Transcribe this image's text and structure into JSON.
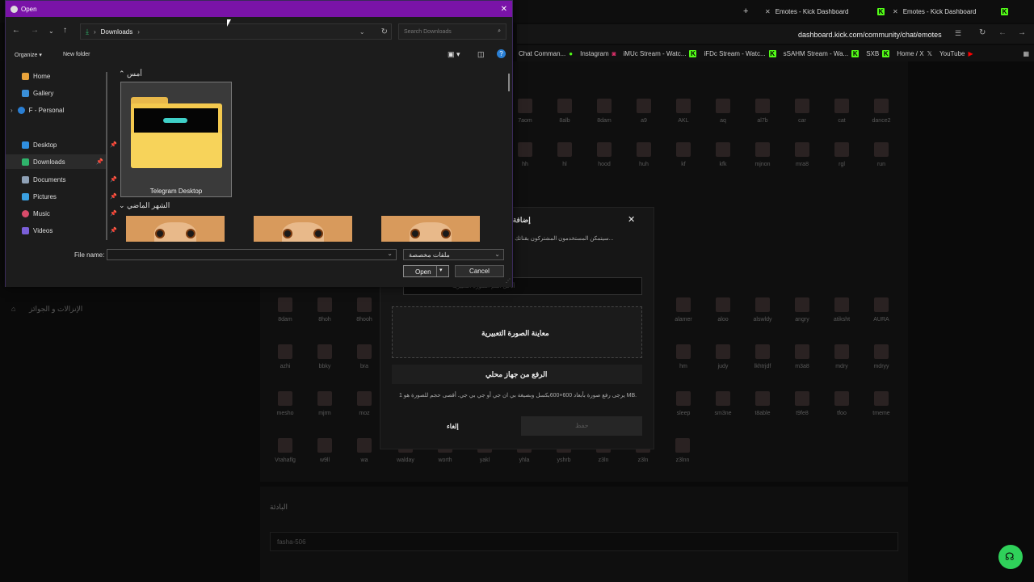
{
  "browser": {
    "tabs": [
      {
        "title": "Emotes - Kick Dashboard"
      },
      {
        "title": "Emotes - Kick Dashboard"
      }
    ],
    "new_tab": "+",
    "url": "dashboard.kick.com/community/chat/emotes",
    "bookmarks": [
      "Chat Comman...",
      "Instagram",
      "iMUc Stream - Watc...",
      "iFDc Stream - Watc...",
      "sSAHM Stream - Wa...",
      "SXB",
      "Home / X",
      "YouTube"
    ]
  },
  "page": {
    "sidebar_item": "الإنزالات و الجوائز",
    "section_label": "البادئة",
    "prefix_value": "fasha-506",
    "emote_labels_top": [
      "7aom",
      "8alb",
      "8dam",
      "a9",
      "AKL",
      "aq",
      "al7b",
      "car",
      "cat",
      "dance2"
    ],
    "emote_labels_row2": [
      "hh",
      "hl",
      "hood",
      "huh",
      "kf",
      "kfk",
      "mjnon",
      "mra8",
      "rgl",
      "run"
    ],
    "emote_labels_left": [
      "8dam",
      "8hoh",
      "8hooh",
      "azhi",
      "bbky",
      "bra",
      "mesho",
      "mjrm",
      "moz",
      "Vrahaflg",
      "w9ll",
      "wa"
    ],
    "emote_labels_right": [
      "alamer",
      "aloo",
      "alswldy",
      "angry",
      "atiksht",
      "AURA",
      "hm",
      "judy",
      "lkhtrjdf",
      "m3a8",
      "mdry",
      "mdryy",
      "sleep",
      "sm3ne",
      "t8able",
      "t9fe8",
      "tfoo",
      "tmeme",
      "walday",
      "worth",
      "yakl",
      "yhla",
      "yshrb",
      "z3ln",
      "z3ln",
      "z3lnn"
    ]
  },
  "modal": {
    "title": "إضافة الم",
    "desc": "سيتمكن المستخدمون المشتركون بقناتك م...",
    "input_placeholder": "أدخل اسم الصورة التعبيرية",
    "preview": "معاينة الصورة التعبيرية",
    "upload": "الرفع من جهاز محلي",
    "hint": "يرجى رفع صورة بأبعاد 600×600بكسل وبصيغة بي ان جي أو جي بي جي. أقصى حجم للصورة هو 1 MB.",
    "cancel": "إلغاء",
    "save": "حفظ"
  },
  "dialog": {
    "title": "Open",
    "path_folder": "Downloads",
    "search_placeholder": "Search Downloads",
    "organize": "Organize",
    "new_folder": "New folder",
    "sidebar": [
      {
        "label": "Home",
        "icon": "home-icon",
        "color": "#e8a33b"
      },
      {
        "label": "Gallery",
        "icon": "gallery-icon",
        "color": "#3a8fd8"
      },
      {
        "label": "F - Personal",
        "icon": "cloud-icon",
        "color": "#2a7fd4"
      },
      {
        "label": "Desktop",
        "icon": "desktop-icon",
        "color": "#2f8fe0"
      },
      {
        "label": "Downloads",
        "icon": "download-icon",
        "color": "#2fb36b"
      },
      {
        "label": "Documents",
        "icon": "document-icon",
        "color": "#8ea0b5"
      },
      {
        "label": "Pictures",
        "icon": "pictures-icon",
        "color": "#3a9fe0"
      },
      {
        "label": "Music",
        "icon": "music-icon",
        "color": "#d84b6a"
      },
      {
        "label": "Videos",
        "icon": "videos-icon",
        "color": "#7a5fd8"
      }
    ],
    "group1": "أمس",
    "folder_name": "Telegram Desktop",
    "group2": "الشهر الماضي",
    "file_name_label": "File name:",
    "file_name_value": "",
    "filter": "ملفات مخصصة",
    "open": "Open",
    "cancel": "Cancel"
  },
  "colors": {
    "title_bar": "#7a13a8",
    "kick_green": "#53fc18"
  }
}
